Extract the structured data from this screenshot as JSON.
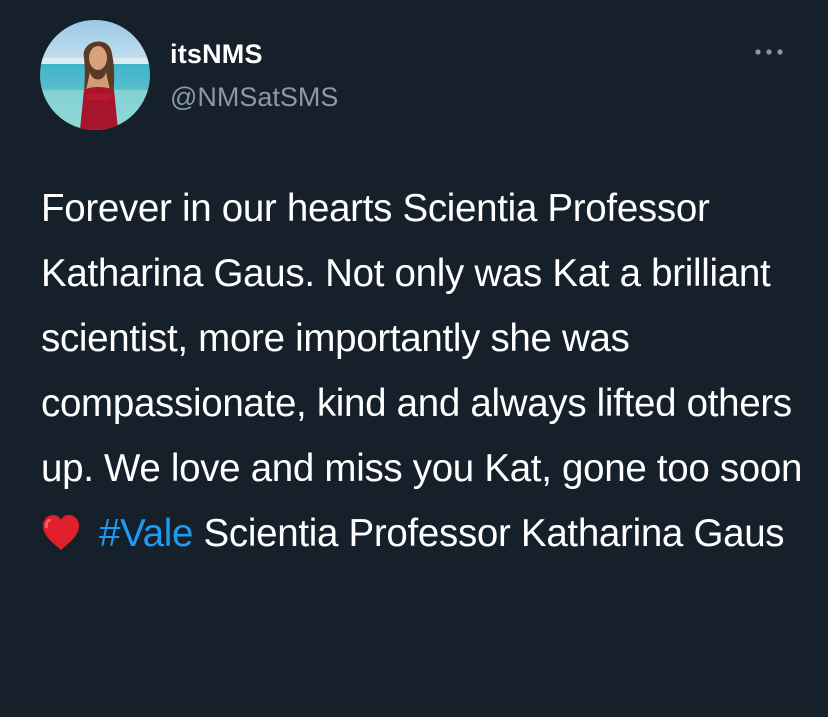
{
  "author": {
    "display_name": "itsNMS",
    "handle": "@NMSatSMS"
  },
  "icons": {
    "more": "more-horizontal-icon",
    "emoji": "red-heart-emoji-icon"
  },
  "colors": {
    "background": "#15202b",
    "text": "#ffffff",
    "secondary_text": "#8b98a5",
    "link": "#1d9bf0",
    "heart": "#e0202a"
  },
  "tweet": {
    "text_before_emoji": "Forever in our hearts Scientia Professor Katharina Gaus. Not only was Kat a brilliant scientist, more importantly she was compassionate, kind and always lifted others up. We love and miss you Kat, gone too soon",
    "hashtag": "#Vale",
    "text_after_hashtag": " Scientia Professor Katharina Gaus"
  }
}
